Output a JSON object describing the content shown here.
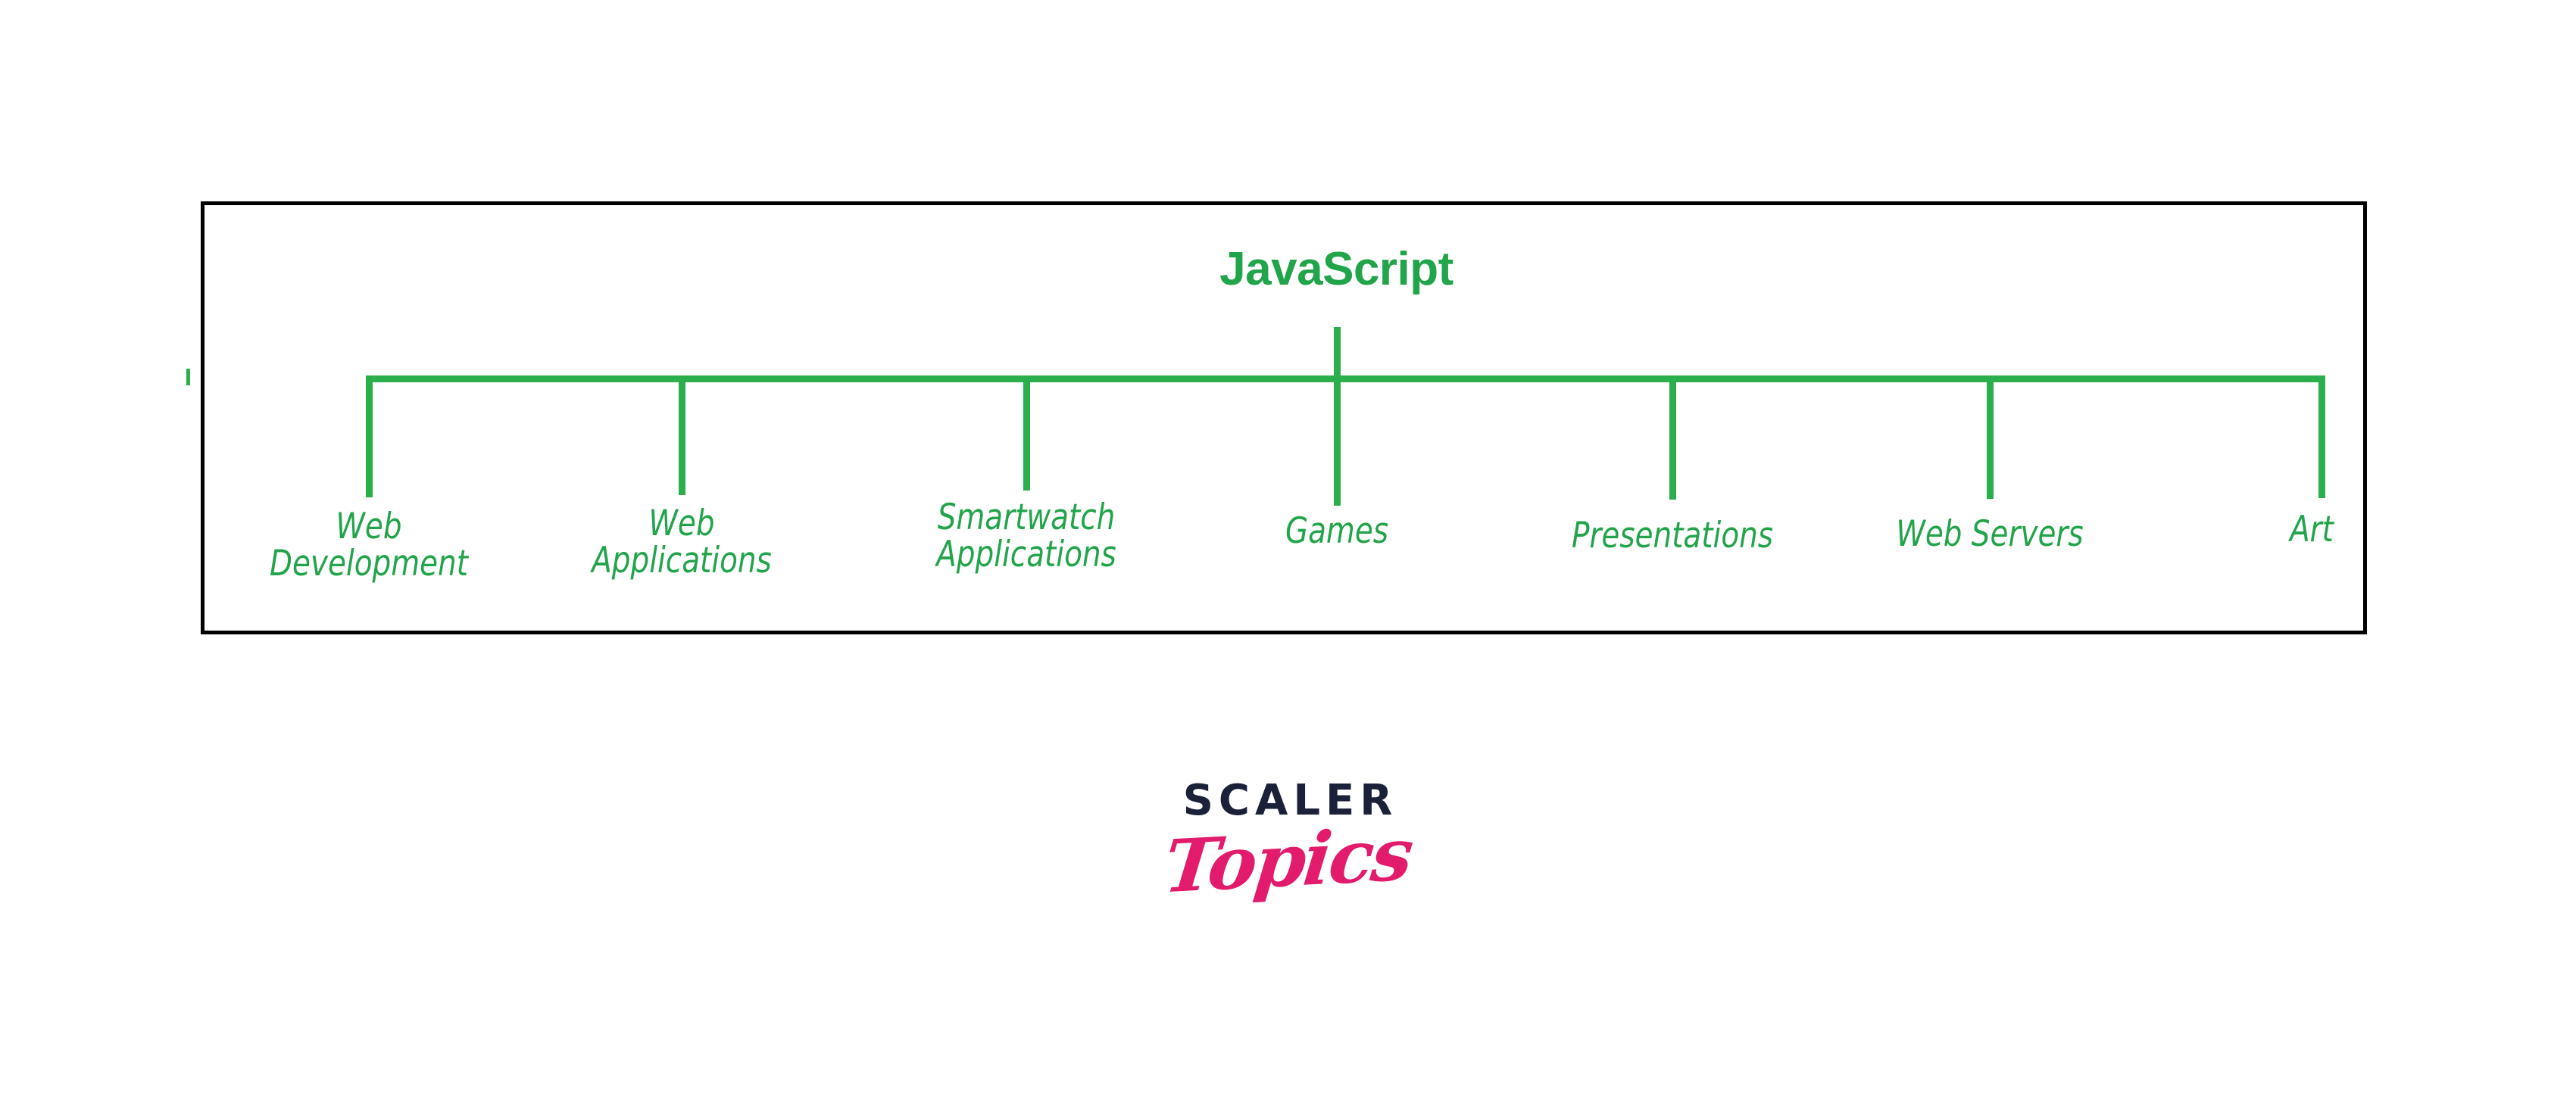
{
  "diagram": {
    "type": "tree",
    "orientation": "top-down",
    "root": {
      "label": "JavaScript"
    },
    "leaves": [
      {
        "label": "Web\nDevelopment"
      },
      {
        "label": "Web\nApplications"
      },
      {
        "label": "Smartwatch\nApplications"
      },
      {
        "label": "Games"
      },
      {
        "label": "Presentations"
      },
      {
        "label": "Web Servers"
      },
      {
        "label": "Art"
      }
    ],
    "colors": {
      "node_text": "#22A44B",
      "connector": "#2BAE4C",
      "frame_border": "#000000",
      "background": "#FFFFFF"
    }
  },
  "logo": {
    "primary": "SCALER",
    "secondary": "Topics",
    "primary_color": "#1B2138",
    "secondary_color": "#E21B6C"
  }
}
